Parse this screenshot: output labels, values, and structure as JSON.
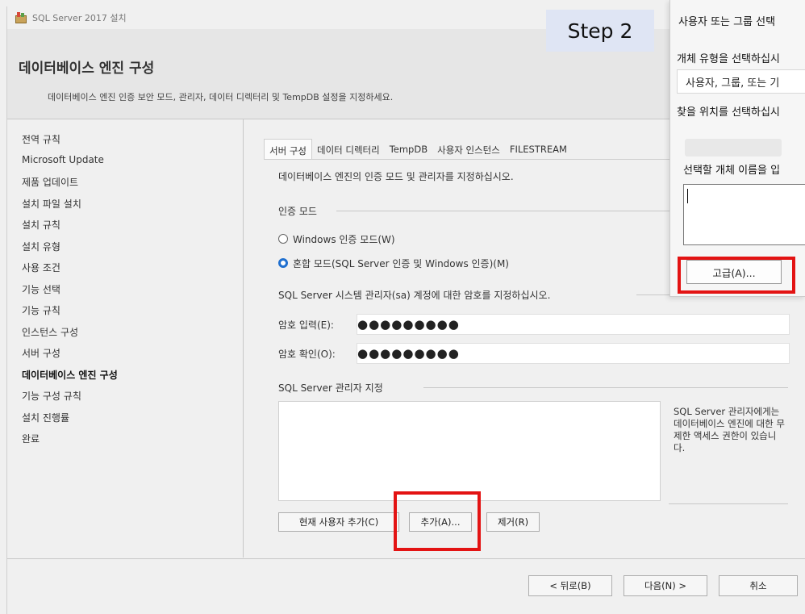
{
  "window": {
    "title": "SQL Server 2017 설치",
    "heading": "데이터베이스 엔진 구성",
    "subtitle": "데이터베이스 엔진 인증 보안 모드, 관리자, 데이터 디렉터리 및 TempDB 설정을 지정하세요."
  },
  "step_badge": "Step 2",
  "sidebar": {
    "items": [
      {
        "label": "전역 규칙"
      },
      {
        "label": "Microsoft Update"
      },
      {
        "label": "제품 업데이트"
      },
      {
        "label": "설치 파일 설치"
      },
      {
        "label": "설치 규칙"
      },
      {
        "label": "설치 유형"
      },
      {
        "label": "사용 조건"
      },
      {
        "label": "기능 선택"
      },
      {
        "label": "기능 규칙"
      },
      {
        "label": "인스턴스 구성"
      },
      {
        "label": "서버 구성"
      },
      {
        "label": "데이터베이스 엔진 구성",
        "active": true
      },
      {
        "label": "기능 구성 규칙"
      },
      {
        "label": "설치 진행률"
      },
      {
        "label": "완료"
      }
    ]
  },
  "tabs": [
    {
      "label": "서버 구성",
      "active": true
    },
    {
      "label": "데이터 디렉터리"
    },
    {
      "label": "TempDB"
    },
    {
      "label": "사용자 인스턴스"
    },
    {
      "label": "FILESTREAM"
    }
  ],
  "server_config": {
    "intro": "데이터베이스 엔진의 인증 모드 및 관리자를 지정하십시오.",
    "auth_group": "인증 모드",
    "windows_auth": "Windows 인증 모드(W)",
    "mixed_auth": "혼합 모드(SQL Server 인증 및 Windows 인증)(M)",
    "selected_mode": "mixed",
    "sa_prompt": "SQL Server 시스템 관리자(sa) 계정에 대한 암호를 지정하십시오.",
    "password_label": "암호 입력(E):",
    "password_value": "●●●●●●●●●",
    "confirm_label": "암호 확인(O):",
    "confirm_value": "●●●●●●●●●",
    "admin_group": "SQL Server 관리자 지정",
    "admin_hint": "SQL Server 관리자에게는 데이터베이스 엔진에 대한 무제한 액세스 권한이 있습니다.",
    "add_current_user": "현재 사용자 추가(C)",
    "add": "추가(A)...",
    "remove": "제거(R)"
  },
  "footer": {
    "back": "< 뒤로(B)",
    "next": "다음(N) >",
    "cancel": "취소"
  },
  "dialog": {
    "title": "사용자 또는 그룹 선택",
    "object_type_label": "개체 유형을 선택하십시",
    "object_type_value": "사용자, 그룹, 또는 기",
    "location_label": "찾을 위치를 선택하십시",
    "names_label": "선택할 개체 이름을 입",
    "advanced": "고급(A)..."
  },
  "highlight_color": "#e31313"
}
